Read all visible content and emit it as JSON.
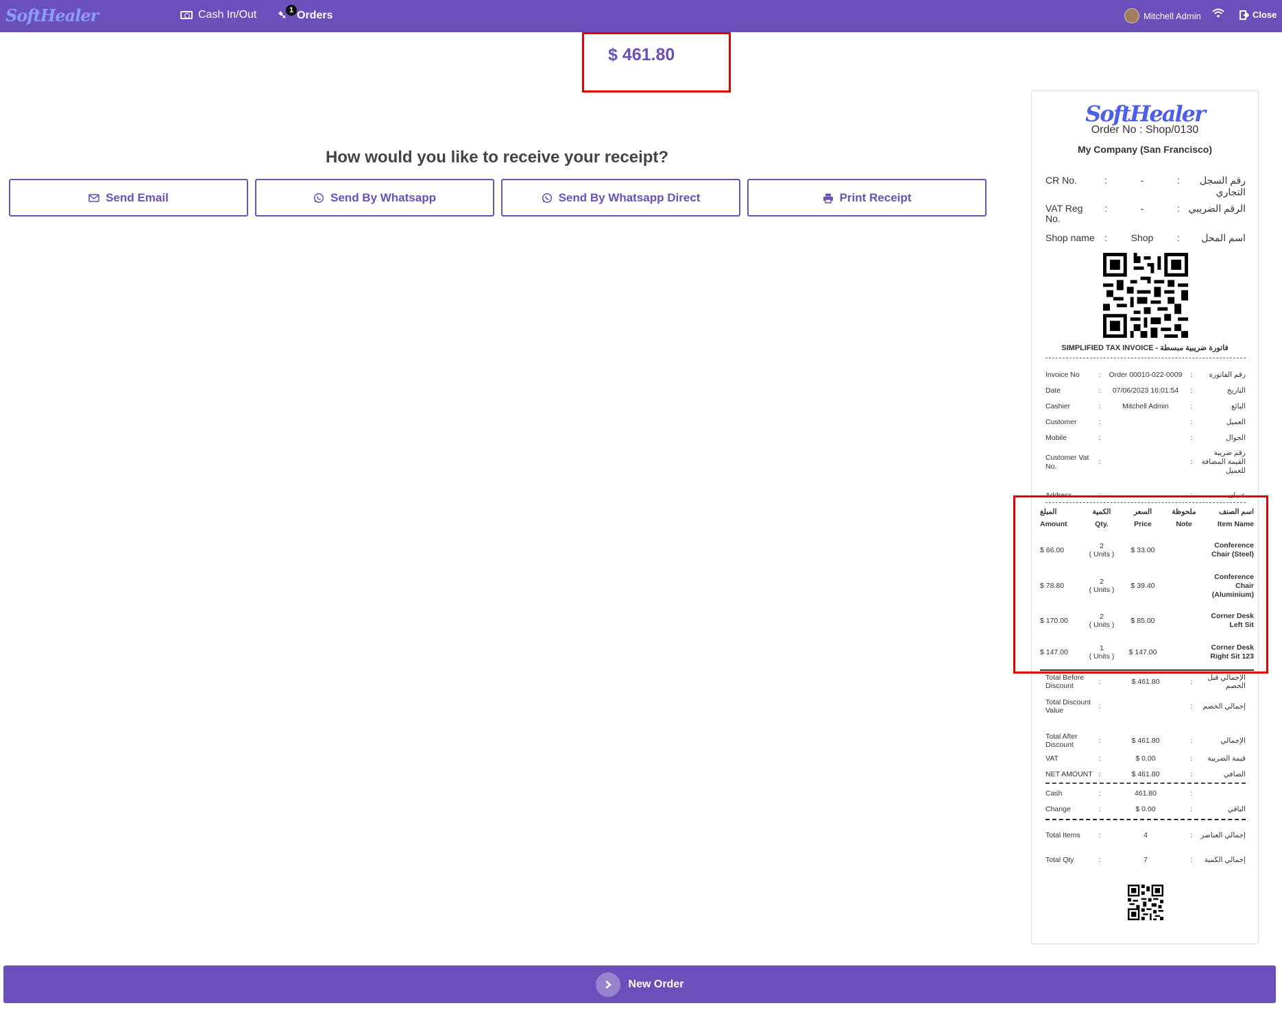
{
  "topbar": {
    "brand": "SoftHealer",
    "cash_label": "Cash In/Out",
    "orders_label": "Orders",
    "orders_badge": "1",
    "user_name": "Mitchell Admin",
    "close_label": "Close"
  },
  "main": {
    "amount": "$ 461.80",
    "question": "How would you like to receive your receipt?",
    "buttons": {
      "email": "Send Email",
      "whatsapp": "Send By Whatsapp",
      "whatsapp_direct": "Send By Whatsapp Direct",
      "print": "Print Receipt"
    }
  },
  "receipt": {
    "logo": "SoftHealer",
    "order_no": "Order No : Shop/0130",
    "company": "My Company (San Francisco)",
    "header_rows": [
      {
        "en": "CR No.",
        "value": "-",
        "ar": "رقم السجل التجاري"
      },
      {
        "en": "VAT Reg No.",
        "value": "-",
        "ar": "الرقم الضريبي"
      },
      {
        "en": "Shop name",
        "value": "Shop",
        "ar": "اسم المحل"
      }
    ],
    "tax_title": "SIMPLIFIED TAX INVOICE - فاتورة ضريبية مبسطة",
    "info_rows": [
      {
        "en": "Invoice No",
        "value": "Order 00010-022-0009",
        "ar": "رقم الفاتورة"
      },
      {
        "en": "Date",
        "value": "07/06/2023 16:01:54",
        "ar": "التاريخ"
      },
      {
        "en": "Cashier",
        "value": "Mitchell Admin",
        "ar": "البائع"
      },
      {
        "en": "Customer",
        "value": "",
        "ar": "العميل"
      },
      {
        "en": "Mobile",
        "value": "",
        "ar": "الجوال"
      },
      {
        "en": "Customer Vat No.",
        "value": "",
        "ar": "رقم ضريبة القيمة المضافة للعميل"
      },
      {
        "en": "Address",
        "value": "",
        "ar": "عنوان"
      }
    ],
    "items_header": {
      "amount_ar": "المبلغ",
      "amount_en": "Amount",
      "qty_ar": "الكمية",
      "qty_en": "Qty.",
      "price_ar": "السعر",
      "price_en": "Price",
      "note_ar": "ملحوظة",
      "note_en": "Note",
      "name_ar": "اسم الصنف",
      "name_en": "Item Name"
    },
    "items": [
      {
        "amount": "$ 66.00",
        "qty": "2",
        "unit": "( Units )",
        "price": "$ 33.00",
        "note": "",
        "name": "Conference Chair (Steel)"
      },
      {
        "amount": "$ 78.80",
        "qty": "2",
        "unit": "( Units )",
        "price": "$ 39.40",
        "note": "",
        "name": "Conference Chair (Aluminium)"
      },
      {
        "amount": "$ 170.00",
        "qty": "2",
        "unit": "( Units )",
        "price": "$ 85.00",
        "note": "",
        "name": "Corner Desk Left Sit"
      },
      {
        "amount": "$ 147.00",
        "qty": "1",
        "unit": "( Units )",
        "price": "$ 147.00",
        "note": "",
        "name": "Corner Desk Right Sit 123"
      }
    ],
    "totals": [
      {
        "en": "Total Before Discount",
        "value": "$ 461.80",
        "ar": "الإجمالي قبل الخصم"
      },
      {
        "en": "Total Discount Value",
        "value": "",
        "ar": "إجمالي الخصم"
      },
      {
        "en": "Total After Discount",
        "value": "$ 461.80",
        "ar": "الإجمالي"
      },
      {
        "en": "VAT",
        "value": "$ 0.00",
        "ar": "قيمة الضريبة"
      },
      {
        "en": "NET AMOUNT",
        "value": "$ 461.80",
        "ar": "الصافي"
      }
    ],
    "payments": [
      {
        "en": "Cash",
        "value": "461.80",
        "ar": ""
      },
      {
        "en": "Change",
        "value": "$ 0.00",
        "ar": "الباقي"
      }
    ],
    "summary": [
      {
        "en": "Total Items",
        "value": "4",
        "ar": "إجمالي العناصر"
      },
      {
        "en": "Total Qty",
        "value": "7",
        "ar": "إجمالي الكمية"
      }
    ]
  },
  "footer": {
    "new_order_label": "New Order"
  },
  "colors": {
    "accent": "#6b4fbb",
    "highlight": "#e00000",
    "logo": "#4d5fe8"
  }
}
